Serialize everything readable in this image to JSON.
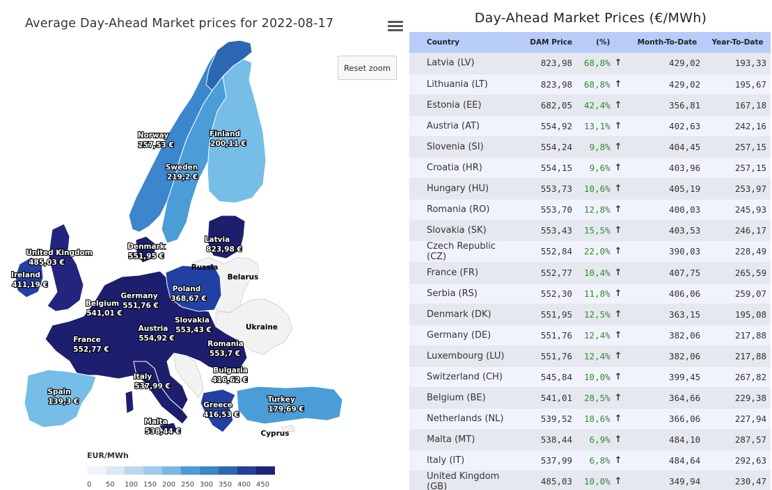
{
  "map": {
    "title": "Average Day-Ahead Market prices for 2022-08-17",
    "reset_zoom_label": "Reset zoom",
    "colors": {
      "darkest": "#1d1e6e",
      "dark": "#23247d",
      "mid_dark": "#2240a3",
      "mid": "#3b86cd",
      "light_mid": "#4a9dd6",
      "light": "#76bde8",
      "no_data": "#f2f2f2"
    },
    "labels": {
      "norway": [
        "Norway",
        "257,53 €"
      ],
      "finland": [
        "Finland",
        "200,11 €"
      ],
      "sweden": [
        "Sweden",
        "219,2 €"
      ],
      "denmark": [
        "Denmark",
        "551,95 €"
      ],
      "latvia": [
        "Latvia",
        "823,98 €"
      ],
      "uk": [
        "United Kingdom",
        "485,03 €"
      ],
      "ireland": [
        "Ireland",
        "411,19 €"
      ],
      "russia": "Russia",
      "belarus": "Belarus",
      "poland": [
        "Poland",
        "368,67 €"
      ],
      "germany": [
        "Germany",
        "551,76 €"
      ],
      "belgium": [
        "Belgium",
        "541,01 €"
      ],
      "slovakia": [
        "Slovakia",
        "553,43 €"
      ],
      "ukraine": "Ukraine",
      "austria": [
        "Austria",
        "554,92 €"
      ],
      "france": [
        "France",
        "552,77 €"
      ],
      "romania": [
        "Romania",
        "553,7 €"
      ],
      "bulgaria": [
        "Bulgaria",
        "416,62 €"
      ],
      "italy": [
        "Italy",
        "537,99 €"
      ],
      "spain": [
        "Spain",
        "139,3 €"
      ],
      "turkey": [
        "Turkey",
        "179,69 €"
      ],
      "greece": [
        "Greece",
        "416,53 €"
      ],
      "malta": [
        "Malta",
        "538,44 €"
      ],
      "cyprus": "Cyprus"
    },
    "legend": {
      "title": "EUR/MWh",
      "ticks": [
        "0",
        "50",
        "100",
        "150",
        "200",
        "250",
        "300",
        "350",
        "400",
        "450"
      ],
      "colors": [
        "#eef4fb",
        "#d8e8f6",
        "#bcd8f0",
        "#9ecaeb",
        "#7ab8e2",
        "#4f9bd4",
        "#3a86c8",
        "#2c67b2",
        "#253f98",
        "#1f2379"
      ]
    }
  },
  "table": {
    "title": "Day-Ahead Market Prices (€/MWh)",
    "columns": [
      "Country",
      "DAM Price",
      "(%)",
      "Month-To-Date",
      "Year-To-Date"
    ],
    "trend_icon": "arrow-up-icon",
    "rows": [
      {
        "country": "Latvia (LV)",
        "dam": "823,98",
        "pct": "68,8%",
        "mtd": "429,02",
        "ytd": "193,33"
      },
      {
        "country": "Lithuania (LT)",
        "dam": "823,98",
        "pct": "68,8%",
        "mtd": "429,02",
        "ytd": "195,67"
      },
      {
        "country": "Estonia (EE)",
        "dam": "682,05",
        "pct": "42,4%",
        "mtd": "356,81",
        "ytd": "167,18"
      },
      {
        "country": "Austria (AT)",
        "dam": "554,92",
        "pct": "13,1%",
        "mtd": "402,63",
        "ytd": "242,16"
      },
      {
        "country": "Slovenia (SI)",
        "dam": "554,24",
        "pct": "9,8%",
        "mtd": "404,45",
        "ytd": "257,15"
      },
      {
        "country": "Croatia (HR)",
        "dam": "554,15",
        "pct": "9,6%",
        "mtd": "403,96",
        "ytd": "257,15"
      },
      {
        "country": "Hungary (HU)",
        "dam": "553,73",
        "pct": "10,6%",
        "mtd": "405,19",
        "ytd": "253,97"
      },
      {
        "country": "Romania (RO)",
        "dam": "553,70",
        "pct": "12,8%",
        "mtd": "400,03",
        "ytd": "245,93"
      },
      {
        "country": "Slovakia (SK)",
        "dam": "553,43",
        "pct": "15,5%",
        "mtd": "403,53",
        "ytd": "246,17"
      },
      {
        "country": "Czech Republic (CZ)",
        "dam": "552,84",
        "pct": "22,0%",
        "mtd": "390,03",
        "ytd": "228,49"
      },
      {
        "country": "France (FR)",
        "dam": "552,77",
        "pct": "10,4%",
        "mtd": "407,75",
        "ytd": "265,59"
      },
      {
        "country": "Serbia (RS)",
        "dam": "552,30",
        "pct": "11,8%",
        "mtd": "406,06",
        "ytd": "259,07"
      },
      {
        "country": "Denmark (DK)",
        "dam": "551,95",
        "pct": "12,5%",
        "mtd": "363,15",
        "ytd": "195,08"
      },
      {
        "country": "Germany (DE)",
        "dam": "551,76",
        "pct": "12,4%",
        "mtd": "382,06",
        "ytd": "217,88"
      },
      {
        "country": "Luxembourg (LU)",
        "dam": "551,76",
        "pct": "12,4%",
        "mtd": "382,06",
        "ytd": "217,88"
      },
      {
        "country": "Switzerland (CH)",
        "dam": "545,84",
        "pct": "10,0%",
        "mtd": "399,45",
        "ytd": "267,82"
      },
      {
        "country": "Belgium (BE)",
        "dam": "541,01",
        "pct": "28,5%",
        "mtd": "364,66",
        "ytd": "229,38"
      },
      {
        "country": "Netherlands (NL)",
        "dam": "539,52",
        "pct": "18,6%",
        "mtd": "366,06",
        "ytd": "227,94"
      },
      {
        "country": "Malta (MT)",
        "dam": "538,44",
        "pct": "6,9%",
        "mtd": "484,10",
        "ytd": "287,57"
      },
      {
        "country": "Italy (IT)",
        "dam": "537,99",
        "pct": "6,8%",
        "mtd": "484,64",
        "ytd": "292,63"
      },
      {
        "country": "United Kingdom (GB)",
        "dam": "485,03",
        "pct": "10,0%",
        "mtd": "349,94",
        "ytd": "230,47"
      }
    ]
  }
}
